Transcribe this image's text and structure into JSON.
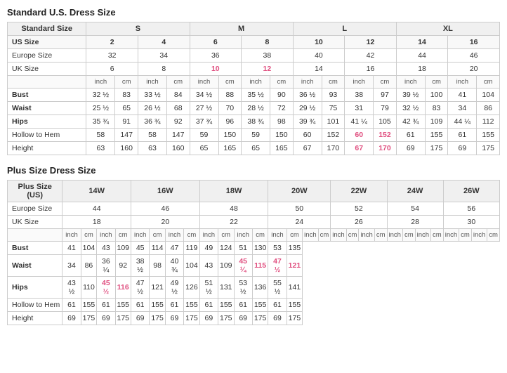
{
  "standard_title": "Standard U.S. Dress Size",
  "plus_title": "Plus Size Dress Size",
  "standard": {
    "size_groups": [
      "S",
      "M",
      "L",
      "XL"
    ],
    "us_sizes": [
      "2",
      "4",
      "6",
      "8",
      "10",
      "12",
      "14",
      "16"
    ],
    "europe_sizes": [
      "32",
      "34",
      "36",
      "38",
      "40",
      "42",
      "44",
      "46"
    ],
    "uk_sizes": [
      "6",
      "8",
      "10",
      "12",
      "14",
      "16",
      "18",
      "20"
    ],
    "uk_pink": [
      2,
      3
    ],
    "rows": [
      {
        "label": "Bust",
        "bold": true,
        "vals": [
          "32 ½",
          "83",
          "33 ½",
          "84",
          "34 ½",
          "88",
          "35 ½",
          "90",
          "36 ½",
          "93",
          "38",
          "97",
          "39 ½",
          "100",
          "41",
          "104"
        ]
      },
      {
        "label": "Waist",
        "bold": true,
        "vals": [
          "25 ½",
          "65",
          "26 ½",
          "68",
          "27 ½",
          "70",
          "28 ½",
          "72",
          "29 ½",
          "75",
          "31",
          "79",
          "32 ½",
          "83",
          "34",
          "86"
        ]
      },
      {
        "label": "Hips",
        "bold": true,
        "vals": [
          "35 ¾",
          "91",
          "36 ¾",
          "92",
          "37 ¾",
          "96",
          "38 ¾",
          "98",
          "39 ¾",
          "101",
          "41 ¼",
          "105",
          "42 ¾",
          "109",
          "44 ¼",
          "112"
        ]
      },
      {
        "label": "Hollow to Hem",
        "bold": false,
        "vals": [
          "58",
          "147",
          "58",
          "147",
          "59",
          "150",
          "59",
          "150",
          "60",
          "152",
          "60",
          "152",
          "61",
          "155",
          "61",
          "155"
        ],
        "pink_cols": [
          10,
          11
        ]
      },
      {
        "label": "Height",
        "bold": false,
        "vals": [
          "63",
          "160",
          "63",
          "160",
          "65",
          "165",
          "65",
          "165",
          "67",
          "170",
          "67",
          "170",
          "69",
          "175",
          "69",
          "175"
        ],
        "pink_cols": [
          10,
          11
        ]
      }
    ]
  },
  "plus": {
    "us_sizes": [
      "14W",
      "16W",
      "18W",
      "20W",
      "22W",
      "24W",
      "26W"
    ],
    "europe_sizes": [
      "44",
      "46",
      "48",
      "50",
      "52",
      "54",
      "56"
    ],
    "uk_sizes": [
      "18",
      "20",
      "22",
      "24",
      "26",
      "28",
      "30"
    ],
    "rows": [
      {
        "label": "Bust",
        "bold": true,
        "vals": [
          "41",
          "104",
          "43",
          "109",
          "45",
          "114",
          "47",
          "119",
          "49",
          "124",
          "51",
          "130",
          "53",
          "135"
        ]
      },
      {
        "label": "Waist",
        "bold": true,
        "vals": [
          "34",
          "86",
          "36 ¼",
          "92",
          "38 ½",
          "98",
          "40 ¾",
          "104",
          "43",
          "109",
          "45 ¼",
          "115",
          "47 ½",
          "121"
        ],
        "pink_cols": [
          10,
          11,
          12,
          13
        ]
      },
      {
        "label": "Hips",
        "bold": true,
        "vals": [
          "43 ½",
          "110",
          "45 ½",
          "116",
          "47 ½",
          "121",
          "49 ½",
          "126",
          "51 ½",
          "131",
          "53 ½",
          "136",
          "55 ½",
          "141"
        ],
        "pink_cols": [
          2,
          3
        ]
      },
      {
        "label": "Hollow to Hem",
        "bold": false,
        "vals": [
          "61",
          "155",
          "61",
          "155",
          "61",
          "155",
          "61",
          "155",
          "61",
          "155",
          "61",
          "155",
          "61",
          "155"
        ]
      },
      {
        "label": "Height",
        "bold": false,
        "vals": [
          "69",
          "175",
          "69",
          "175",
          "69",
          "175",
          "69",
          "175",
          "69",
          "175",
          "69",
          "175",
          "69",
          "175"
        ]
      }
    ]
  }
}
